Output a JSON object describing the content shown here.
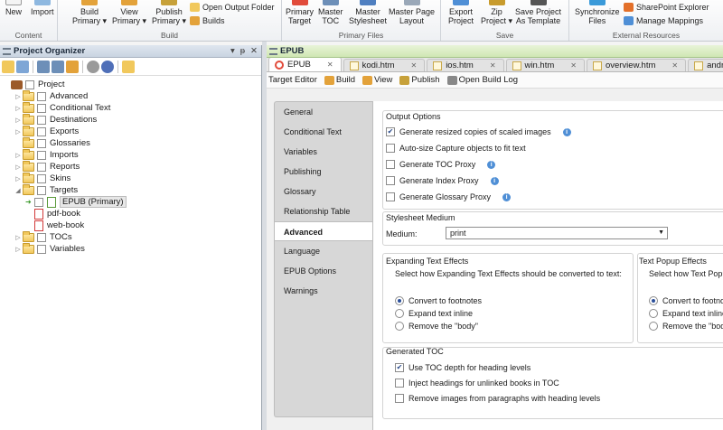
{
  "ribbon": {
    "content_group": {
      "label": "Content",
      "new": "New",
      "import": "Import"
    },
    "build_group": {
      "label": "Build",
      "build_primary": "Build\nPrimary ▾",
      "view_primary": "View\nPrimary ▾",
      "publish_primary": "Publish\nPrimary ▾",
      "open_output_folder": "Open Output Folder",
      "builds": "Builds"
    },
    "primary_files_group": {
      "label": "Primary Files",
      "primary_target": "Primary\nTarget",
      "master_toc": "Master\nTOC",
      "master_stylesheet": "Master\nStylesheet",
      "master_page_layout": "Master Page\nLayout"
    },
    "save_group": {
      "label": "Save",
      "export_project": "Export\nProject",
      "zip_project": "Zip\nProject ▾",
      "save_as_template": "Save Project\nAs Template"
    },
    "external_group": {
      "label": "External Resources",
      "synchronize_files": "Synchronize\nFiles",
      "sharepoint_explorer": "SharePoint Explorer",
      "manage_mappings": "Manage Mappings"
    }
  },
  "project_organizer": {
    "title": "Project Organizer",
    "controls": [
      "▾",
      "ᵽ",
      "✕"
    ],
    "tree": [
      {
        "label": "Project",
        "level": 0,
        "icon": "briefcase-icon",
        "expander": ""
      },
      {
        "label": "Advanced",
        "level": 1,
        "icon": "folder-icon",
        "expander": "▷"
      },
      {
        "label": "Conditional Text",
        "level": 1,
        "icon": "folder-icon",
        "expander": "▷"
      },
      {
        "label": "Destinations",
        "level": 1,
        "icon": "folder-icon",
        "expander": "▷"
      },
      {
        "label": "Exports",
        "level": 1,
        "icon": "folder-icon",
        "expander": "▷"
      },
      {
        "label": "Glossaries",
        "level": 1,
        "icon": "folder-icon",
        "expander": ""
      },
      {
        "label": "Imports",
        "level": 1,
        "icon": "folder-icon",
        "expander": "▷"
      },
      {
        "label": "Reports",
        "level": 1,
        "icon": "folder-icon",
        "expander": "▷"
      },
      {
        "label": "Skins",
        "level": 1,
        "icon": "folder-icon",
        "expander": "▷"
      },
      {
        "label": "Targets",
        "level": 1,
        "icon": "folder-icon",
        "expander": "◢"
      },
      {
        "label": "EPUB (Primary)",
        "level": 2,
        "icon": "epub-target-icon",
        "expander": "",
        "selected": true
      },
      {
        "label": "pdf-book",
        "level": 2,
        "icon": "pdf-target-icon",
        "expander": ""
      },
      {
        "label": "web-book",
        "level": 2,
        "icon": "web-target-icon",
        "expander": ""
      },
      {
        "label": "TOCs",
        "level": 1,
        "icon": "folder-icon",
        "expander": "▷"
      },
      {
        "label": "Variables",
        "level": 1,
        "icon": "folder-icon",
        "expander": "▷"
      }
    ]
  },
  "document": {
    "panel_title": "EPUB",
    "tabs": [
      {
        "label": "EPUB",
        "icon": "target-icon",
        "active": true
      },
      {
        "label": "kodi.htm",
        "icon": "page-icon",
        "active": false
      },
      {
        "label": "ios.htm",
        "icon": "page-icon",
        "active": false
      },
      {
        "label": "win.htm",
        "icon": "page-icon",
        "active": false
      },
      {
        "label": "overview.htm",
        "icon": "page-icon",
        "active": false
      },
      {
        "label": "android.htm",
        "icon": "page-icon",
        "active": false
      }
    ],
    "tab_close": "✕",
    "subtoolbar": {
      "target_editor": "Target Editor",
      "build": "Build",
      "view": "View",
      "publish": "Publish",
      "open_build_log": "Open Build Log"
    }
  },
  "editor": {
    "side_tabs": [
      "General",
      "Conditional Text",
      "Variables",
      "Publishing",
      "Glossary",
      "Relationship Table",
      "Advanced",
      "Language",
      "EPUB Options",
      "Warnings"
    ],
    "active_side_tab": "Advanced",
    "output_options": {
      "title": "Output Options",
      "items": [
        {
          "label": "Generate resized copies of scaled images",
          "checked": true,
          "info": true
        },
        {
          "label": "Auto-size Capture objects to fit text",
          "checked": false,
          "info": false
        },
        {
          "label": "Generate TOC Proxy",
          "checked": false,
          "info": true
        },
        {
          "label": "Generate Index Proxy",
          "checked": false,
          "info": true
        },
        {
          "label": "Generate Glossary Proxy",
          "checked": false,
          "info": true
        }
      ]
    },
    "stylesheet_medium": {
      "title": "Stylesheet Medium",
      "medium_label": "Medium:",
      "medium_value": "print"
    },
    "expanding_text_effects": {
      "title": "Expanding Text Effects",
      "description": "Select how Expanding Text Effects should be converted to text:",
      "options": [
        "Convert to footnotes",
        "Expand text inline",
        "Remove the \"body\""
      ],
      "selected": 0
    },
    "text_popup_effects": {
      "title": "Text Popup Effects",
      "description": "Select how Text Popup",
      "options": [
        "Convert to footnot",
        "Expand text inline",
        "Remove the \"body\""
      ],
      "selected": 0
    },
    "generated_toc": {
      "title": "Generated TOC",
      "items": [
        {
          "label": "Use TOC depth for heading levels",
          "checked": true
        },
        {
          "label": "Inject headings for unlinked books in TOC",
          "checked": false
        },
        {
          "label": "Remove images from paragraphs with heading levels",
          "checked": false
        }
      ]
    }
  }
}
